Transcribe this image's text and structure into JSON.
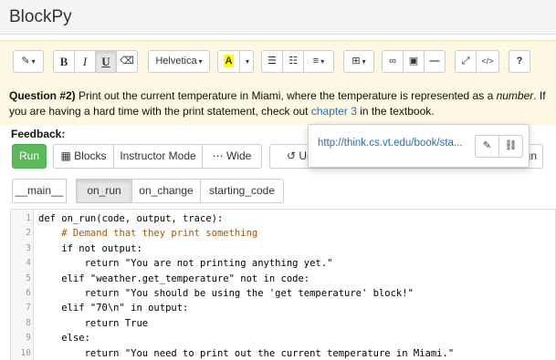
{
  "app": {
    "title": "BlockPy"
  },
  "toolbar": {
    "magic_icon": "magic-wand-icon",
    "bold": "B",
    "italic": "I",
    "underline": "U",
    "eraser_icon": "eraser-icon",
    "font": "Helvetica",
    "color_label": "A",
    "ul_icon": "unordered-list-icon",
    "ol_icon": "ordered-list-icon",
    "align_icon": "align-left-icon",
    "table_icon": "table-icon",
    "link_icon": "link-icon",
    "image_icon": "image-icon",
    "hr_icon": "horizontal-rule-icon",
    "fullscreen_icon": "fullscreen-icon",
    "codeview_label": "</>",
    "help_label": "?"
  },
  "question": {
    "label": "Question #2)",
    "text_before": " Print out the current temperature in Miami, where the temperature is represented as a ",
    "emphasis": "number",
    "text_middle": ". If you are having a hard time with the print statement, check out ",
    "link_text": "chapter 3",
    "text_after": " in the textbook."
  },
  "feedback": {
    "label": "Feedback:"
  },
  "buttons": {
    "run": "Run",
    "blocks": "Blocks",
    "instructor_mode": "Instructor Mode",
    "wide": "Wide",
    "undo": "Undo",
    "align_partial": "lign"
  },
  "link_popover": {
    "url": "http://think.cs.vt.edu/book/sta...",
    "edit_icon": "edit-link-icon",
    "unlink_icon": "unlink-icon"
  },
  "tabs": [
    {
      "label": "__main__",
      "active": false
    },
    {
      "label": "on_run",
      "active": true
    },
    {
      "label": "on_change",
      "active": false
    },
    {
      "label": "starting_code",
      "active": false
    }
  ],
  "code_lines": [
    {
      "n": "1",
      "text": "def on_run(code, output, trace):"
    },
    {
      "n": "2",
      "text": "    # Demand that they print something"
    },
    {
      "n": "3",
      "text": "    if not output:"
    },
    {
      "n": "4",
      "text": "        return \"You are not printing anything yet.\""
    },
    {
      "n": "5",
      "text": "    elif \"weather.get_temperature\" not in code:"
    },
    {
      "n": "6",
      "text": "        return \"You should be using the 'get temperature' block!\""
    },
    {
      "n": "7",
      "text": "    elif \"70\\n\" in output:"
    },
    {
      "n": "8",
      "text": "        return True"
    },
    {
      "n": "9",
      "text": "    else:"
    },
    {
      "n": "10",
      "text": "        return \"You need to print out the current temperature in Miami.\""
    }
  ]
}
